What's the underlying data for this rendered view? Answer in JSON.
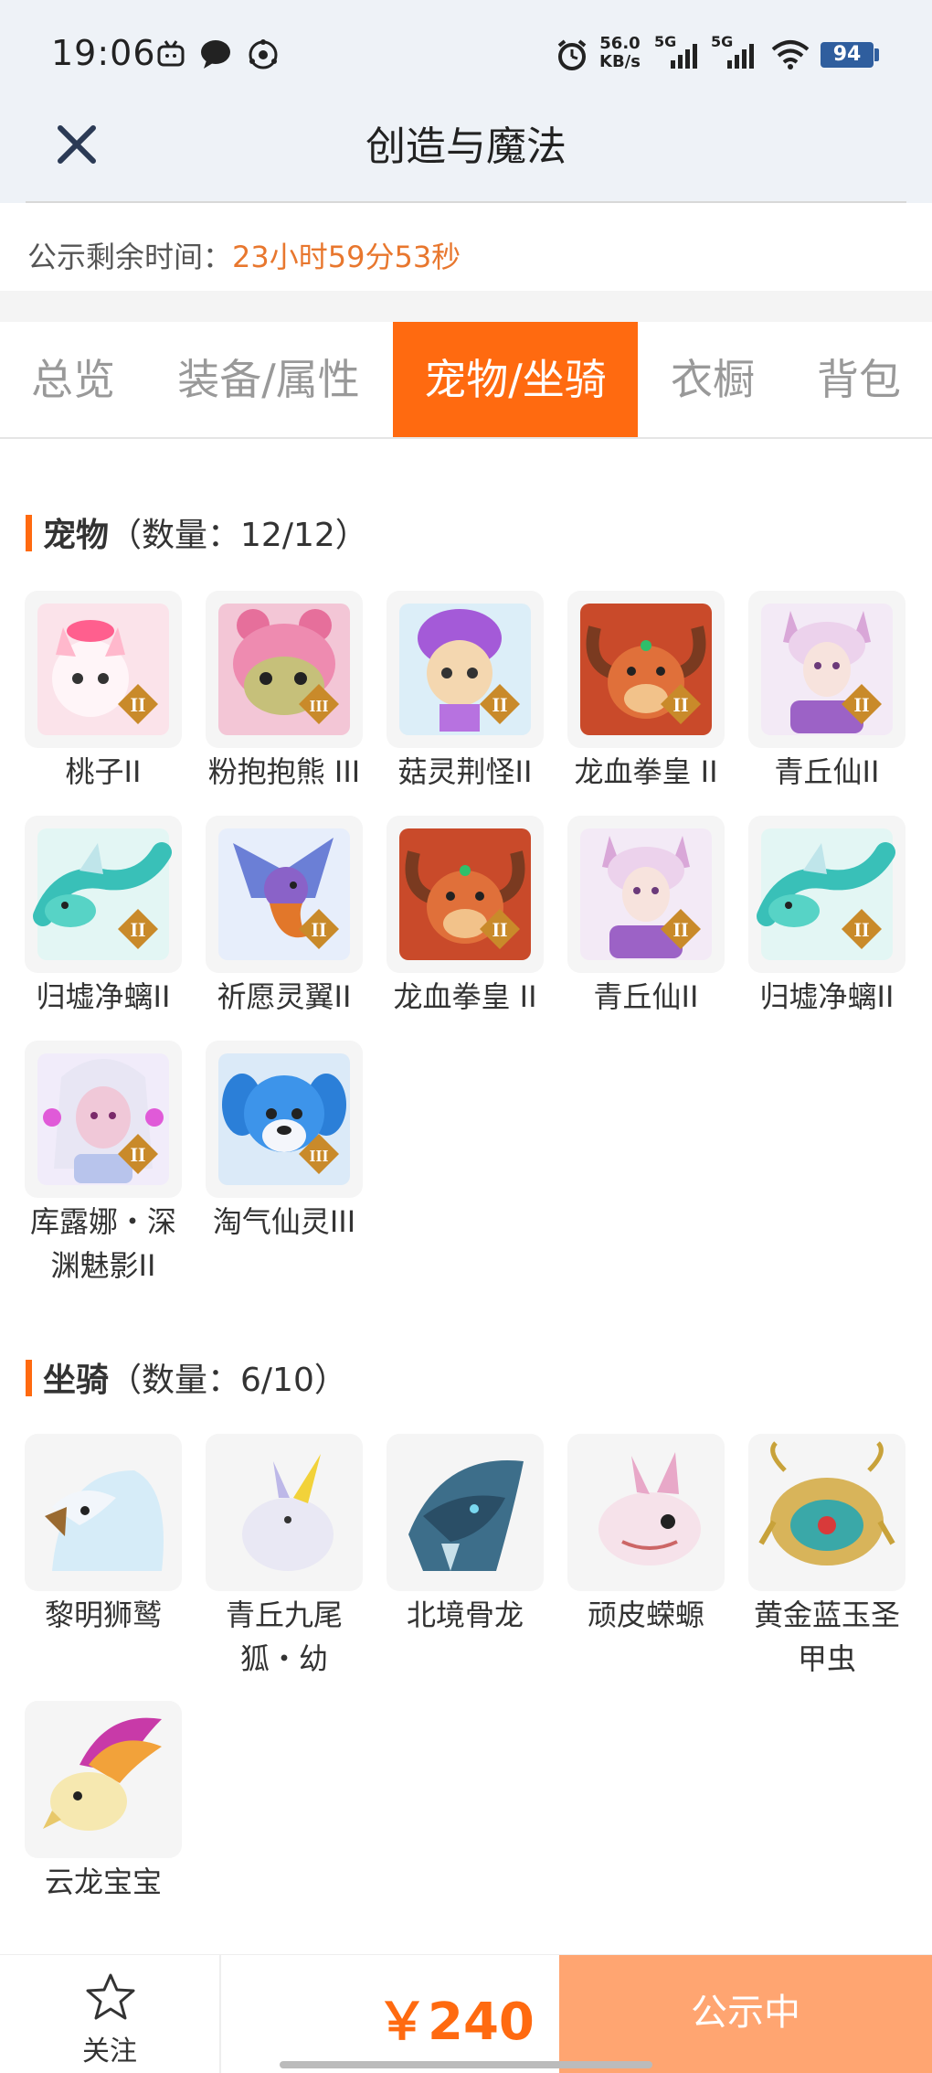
{
  "status_bar": {
    "time": "19:06",
    "net_speed_value": "56.0",
    "net_speed_unit": "KB/s",
    "signal_1": "5G",
    "signal_2": "5G",
    "battery": "94",
    "icons": [
      "tv-icon",
      "chat-bubble-icon",
      "sync-icon",
      "alarm-icon",
      "signal-icon",
      "wifi-icon",
      "battery-icon"
    ]
  },
  "header": {
    "title": "创造与魔法",
    "close_icon": "close-icon"
  },
  "notice": {
    "label": "公示剩余时间：",
    "countdown": "23小时59分53秒"
  },
  "tabs": [
    {
      "label": "总览",
      "active": false
    },
    {
      "label": "装备/属性",
      "active": false
    },
    {
      "label": "宠物/坐骑",
      "active": true
    },
    {
      "label": "衣橱",
      "active": false
    },
    {
      "label": "背包",
      "active": false
    }
  ],
  "pets": {
    "title": "宠物",
    "count_text": "（数量：12/12）",
    "items": [
      {
        "name": "桃子II",
        "rank": "II"
      },
      {
        "name": "粉抱抱熊 III",
        "rank": "III"
      },
      {
        "name": "菇灵荆怪II",
        "rank": "II"
      },
      {
        "name": "龙血拳皇 II",
        "rank": "II"
      },
      {
        "name": "青丘仙II",
        "rank": "II"
      },
      {
        "name": "归墟净螭II",
        "rank": "II"
      },
      {
        "name": "祈愿灵翼II",
        "rank": "II"
      },
      {
        "name": "龙血拳皇 II",
        "rank": "II"
      },
      {
        "name": "青丘仙II",
        "rank": "II"
      },
      {
        "name": "归墟净螭II",
        "rank": "II"
      },
      {
        "name": "库露娜・深渊魅影II",
        "rank": "II"
      },
      {
        "name": "淘气仙灵III",
        "rank": "III"
      }
    ]
  },
  "mounts": {
    "title": "坐骑",
    "count_text": "（数量：6/10）",
    "items": [
      {
        "name": "黎明狮鹫"
      },
      {
        "name": "青丘九尾狐・幼"
      },
      {
        "name": "北境骨龙"
      },
      {
        "name": "顽皮蝾螈"
      },
      {
        "name": "黄金蓝玉圣甲虫"
      },
      {
        "name": "云龙宝宝"
      }
    ]
  },
  "bottom": {
    "follow_label": "关注",
    "follow_icon": "star-icon",
    "price": "￥240",
    "status_button": "公示中"
  },
  "colors": {
    "accent": "#ff6a10",
    "countdown": "#e8772e",
    "status_button_bg": "#ffa571",
    "header_bg": "#eef2f7"
  }
}
